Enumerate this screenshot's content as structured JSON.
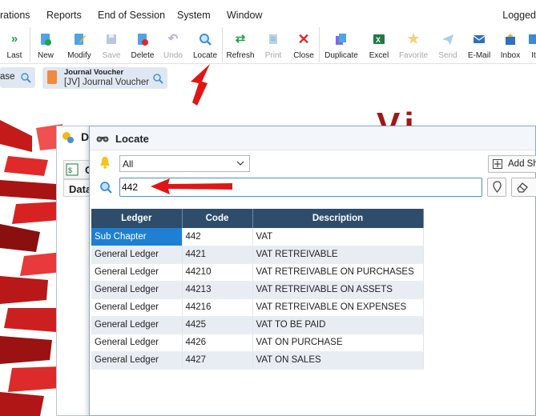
{
  "menu": {
    "items": [
      "rations",
      "Reports",
      "End of Session",
      "System",
      "Window"
    ],
    "user": "Logged"
  },
  "toolbar": {
    "buttons": [
      {
        "label": "Last",
        "icon": "last-icon",
        "disabled": false
      },
      {
        "label": "New",
        "icon": "new-icon",
        "disabled": false
      },
      {
        "label": "Modify",
        "icon": "modify-icon",
        "disabled": false
      },
      {
        "label": "Save",
        "icon": "save-icon",
        "disabled": true
      },
      {
        "label": "Delete",
        "icon": "delete-icon",
        "disabled": false
      },
      {
        "label": "Undo",
        "icon": "undo-icon",
        "disabled": true
      },
      {
        "label": "Locate",
        "icon": "locate-icon",
        "disabled": false
      },
      {
        "label": "Refresh",
        "icon": "refresh-icon",
        "disabled": false
      },
      {
        "label": "Print",
        "icon": "print-icon",
        "disabled": true
      },
      {
        "label": "Close",
        "icon": "close-icon",
        "disabled": false
      },
      {
        "label": "Duplicate",
        "icon": "duplicate-icon",
        "disabled": false
      },
      {
        "label": "Excel",
        "icon": "excel-icon",
        "disabled": false
      },
      {
        "label": "Favorite",
        "icon": "star-icon",
        "disabled": true
      },
      {
        "label": "Send",
        "icon": "send-icon",
        "disabled": true
      },
      {
        "label": "E-Mail",
        "icon": "email-icon",
        "disabled": false
      },
      {
        "label": "Inbox",
        "icon": "inbox-icon",
        "disabled": false
      },
      {
        "label": "It",
        "icon": "item-icon",
        "disabled": false
      }
    ]
  },
  "tabs": {
    "tab1_label": "ase",
    "tab2_title": "Journal Voucher",
    "tab2_subtitle": "[JV] Journal Voucher"
  },
  "background_window": {
    "title": "Di",
    "sub_label": "C",
    "data_label": "Data"
  },
  "brand_text": "Vi",
  "locate": {
    "title": "Locate",
    "filter_value": "All",
    "search_value": "442",
    "add_button_label": "Add Sh",
    "columns": [
      "Ledger",
      "Code",
      "Description"
    ],
    "rows": [
      {
        "ledger": "Sub Chapter",
        "code": "442",
        "description": "VAT"
      },
      {
        "ledger": "General Ledger",
        "code": "4421",
        "description": "VAT RETREIVABLE"
      },
      {
        "ledger": "General Ledger",
        "code": "44210",
        "description": "VAT RETREIVABLE ON PURCHASES"
      },
      {
        "ledger": "General Ledger",
        "code": "44213",
        "description": "VAT RETREIVABLE ON ASSETS"
      },
      {
        "ledger": "General Ledger",
        "code": "44216",
        "description": "VAT RETREIVABLE ON EXPENSES"
      },
      {
        "ledger": "General Ledger",
        "code": "4425",
        "description": "VAT TO BE PAID"
      },
      {
        "ledger": "General Ledger",
        "code": "4426",
        "description": "VAT ON PURCHASE"
      },
      {
        "ledger": "General Ledger",
        "code": "4427",
        "description": "VAT ON SALES"
      }
    ]
  },
  "colors": {
    "header_bg": "#2e4d6b",
    "selected": "#1e7fd3",
    "annotation_red": "#e01616"
  }
}
